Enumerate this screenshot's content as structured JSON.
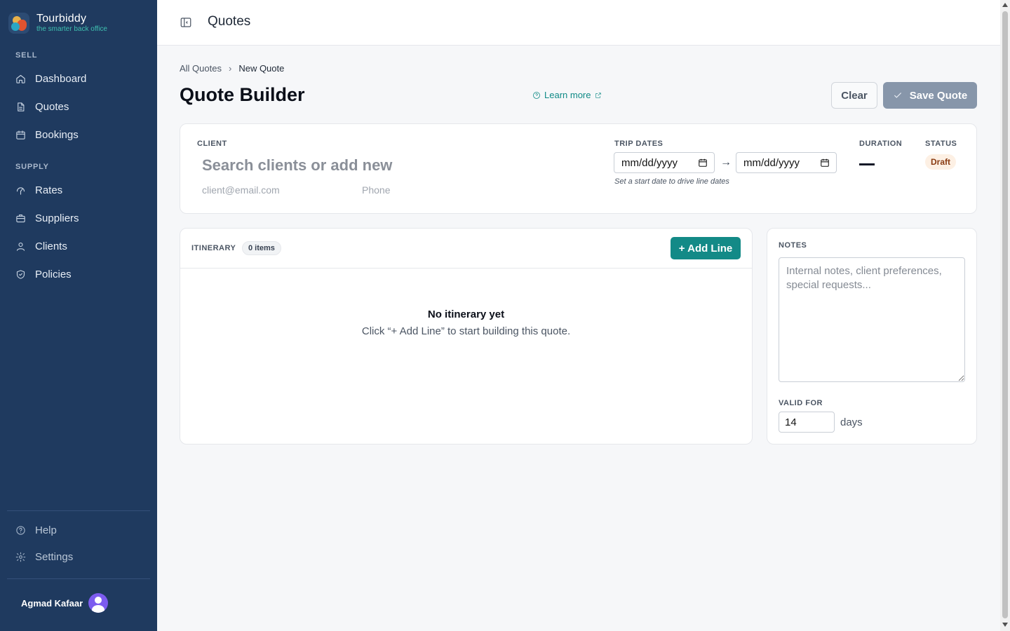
{
  "brand": {
    "name": "Tourbiddy",
    "tagline": "the smarter back office"
  },
  "sidebar": {
    "sections": [
      {
        "title": "SELL"
      },
      {
        "title": "SUPPLY"
      }
    ],
    "items": [
      {
        "label": "Dashboard",
        "icon": "home-icon"
      },
      {
        "label": "Quotes",
        "icon": "document-icon"
      },
      {
        "label": "Bookings",
        "icon": "calendar-icon"
      },
      {
        "label": "Rates",
        "icon": "rates-icon"
      },
      {
        "label": "Suppliers",
        "icon": "briefcase-icon"
      },
      {
        "label": "Clients",
        "icon": "users-icon"
      },
      {
        "label": "Policies",
        "icon": "shield-icon"
      }
    ],
    "footer_items": [
      {
        "label": "Help",
        "icon": "help-icon"
      },
      {
        "label": "Settings",
        "icon": "gear-icon"
      }
    ],
    "user": {
      "name": "Agmad Kafaar"
    }
  },
  "topbar": {
    "title": "Quotes"
  },
  "breadcrumb": {
    "parent": "All Quotes",
    "current": "New Quote"
  },
  "header": {
    "title": "Quote Builder",
    "learn_more": "Learn more",
    "clear_label": "Clear",
    "save_label": "Save Quote"
  },
  "client_card": {
    "client_label": "CLIENT",
    "search_placeholder": "Search clients or add new",
    "email_placeholder": "client@email.com",
    "phone_placeholder": "Phone",
    "trip_dates_label": "TRIP DATES",
    "start_date": "mm/dd/yyyy",
    "end_date": "mm/dd/yyyy",
    "arrow": "→",
    "dates_hint": "Set a start date to drive line dates",
    "duration_label": "DURATION",
    "status_label": "STATUS",
    "status_value": "Draft",
    "status_color": "#fdf0e4"
  },
  "itinerary": {
    "label": "ITINERARY",
    "count": "0 items",
    "add_label": "+ Add Line",
    "empty_title": "No itinerary yet",
    "empty_sub": "Click “+ Add Line” to start building this quote."
  },
  "notes": {
    "label": "NOTES",
    "placeholder": "Internal notes, client preferences, special requests...",
    "valid_label": "VALID FOR",
    "valid_value": "14",
    "valid_unit": "days"
  },
  "colors": {
    "sidebar": "#1f3a5f",
    "accent": "#138a87",
    "save_disabled": "#8796aa"
  }
}
